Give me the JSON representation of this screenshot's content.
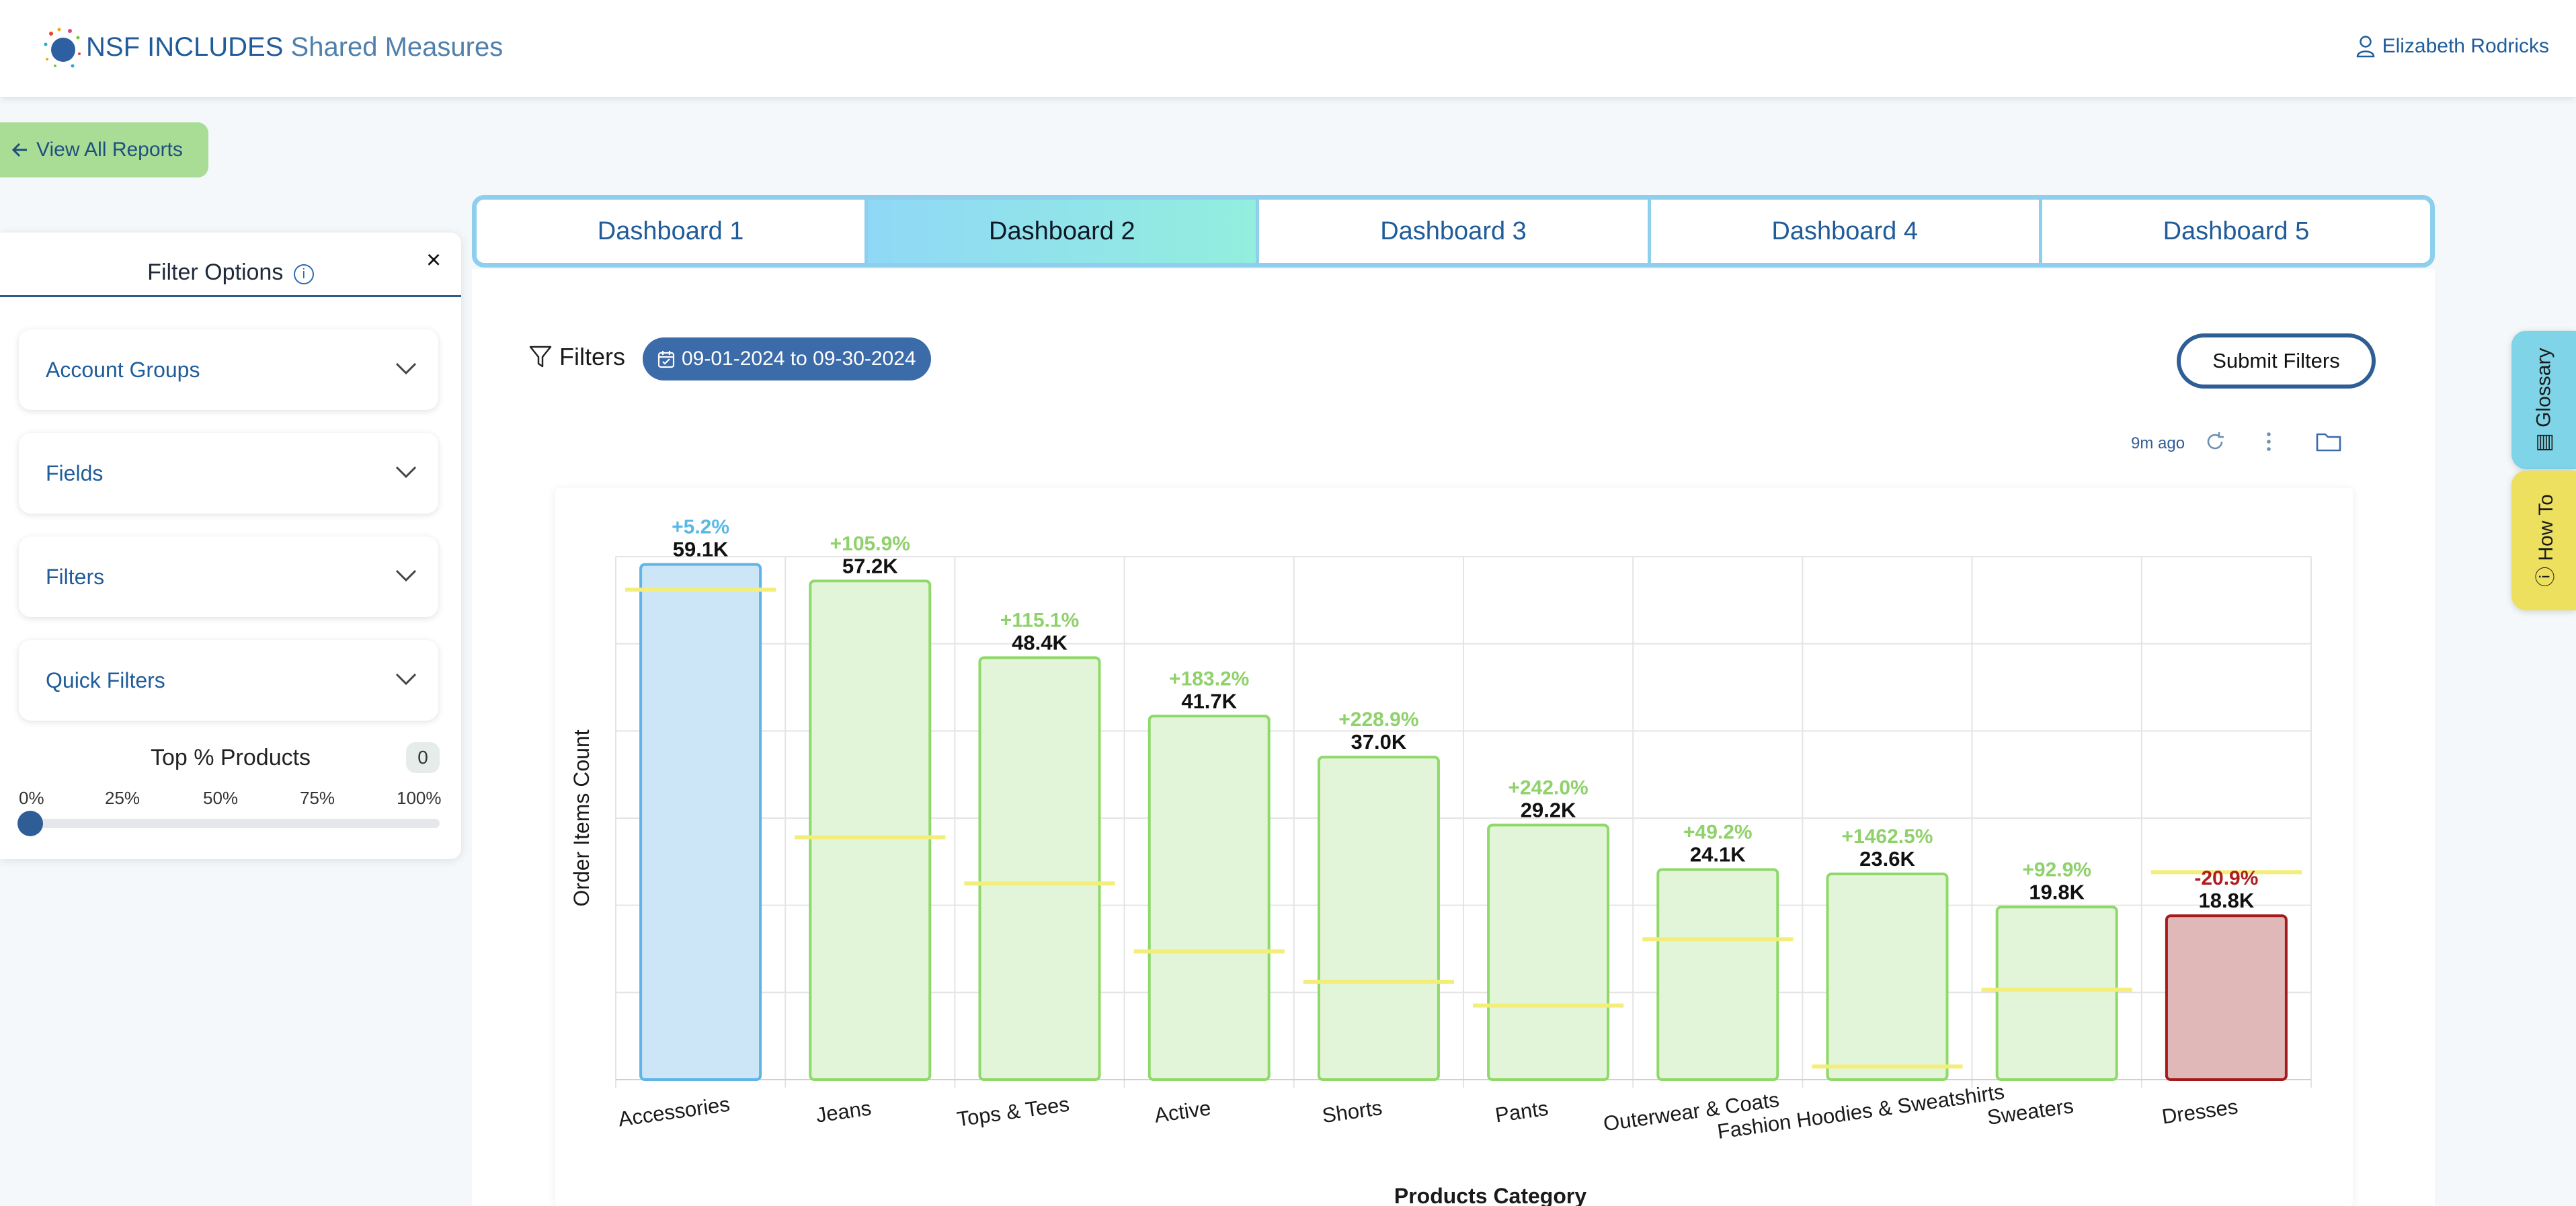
{
  "header": {
    "brand_strong": "NSF INCLUDES",
    "brand_light": "Shared Measures",
    "user_name": "Elizabeth Rodricks"
  },
  "back_button": {
    "label": "View All Reports"
  },
  "filter_panel": {
    "title": "Filter Options",
    "close": "×",
    "sections": [
      "Account Groups",
      "Fields",
      "Filters",
      "Quick Filters"
    ],
    "top_percent": {
      "label": "Top % Products",
      "value": "0",
      "ticks": [
        "0%",
        "25%",
        "50%",
        "75%",
        "100%"
      ],
      "level": 0
    }
  },
  "tabs": [
    {
      "label": "Dashboard 1",
      "active": false
    },
    {
      "label": "Dashboard 2",
      "active": true
    },
    {
      "label": "Dashboard 3",
      "active": false
    },
    {
      "label": "Dashboard 4",
      "active": false
    },
    {
      "label": "Dashboard 5",
      "active": false
    }
  ],
  "toolbar": {
    "filters_label": "Filters",
    "date_range": "09-01-2024 to 09-30-2024",
    "submit_label": "Submit Filters",
    "updated": "9m ago"
  },
  "side_tabs": {
    "glossary": "Glossary",
    "howto": "How To"
  },
  "colors": {
    "brand_blue": "#1f5c99",
    "bar_blue": "#cde6f7",
    "bar_green": "#e3f5d8",
    "bar_red": "#e0b8b8",
    "pct_up": "#8fd16a",
    "pct_down": "#b01c1c",
    "pct_first": "#5ab8e6",
    "reference_line": "#f3ee7a"
  },
  "chart_data": {
    "type": "bar",
    "xlabel": "Products Category",
    "ylabel": "Order Items Count",
    "ylim": [
      0,
      60000
    ],
    "grid": true,
    "categories": [
      "Accessories",
      "Jeans",
      "Tops & Tees",
      "Active",
      "Shorts",
      "Pants",
      "Outerwear & Coats",
      "Fashion Hoodies & Sweatshirts",
      "Sweaters",
      "Dresses"
    ],
    "values": [
      59100,
      57200,
      48400,
      41700,
      37000,
      29200,
      24100,
      23600,
      19800,
      18800
    ],
    "value_labels": [
      "59.1K",
      "57.2K",
      "48.4K",
      "41.7K",
      "37.0K",
      "29.2K",
      "24.1K",
      "23.6K",
      "19.8K",
      "18.8K"
    ],
    "change_labels": [
      "+5.2%",
      "+105.9%",
      "+115.1%",
      "+183.2%",
      "+228.9%",
      "+242.0%",
      "+49.2%",
      "+1462.5%",
      "+92.9%",
      "-20.9%"
    ],
    "reference_values": [
      56200,
      27800,
      22500,
      14700,
      11200,
      8500,
      16100,
      1500,
      10300,
      23800
    ],
    "bar_styles": [
      "blue",
      "green",
      "green",
      "green",
      "green",
      "green",
      "green",
      "green",
      "green",
      "red"
    ]
  }
}
